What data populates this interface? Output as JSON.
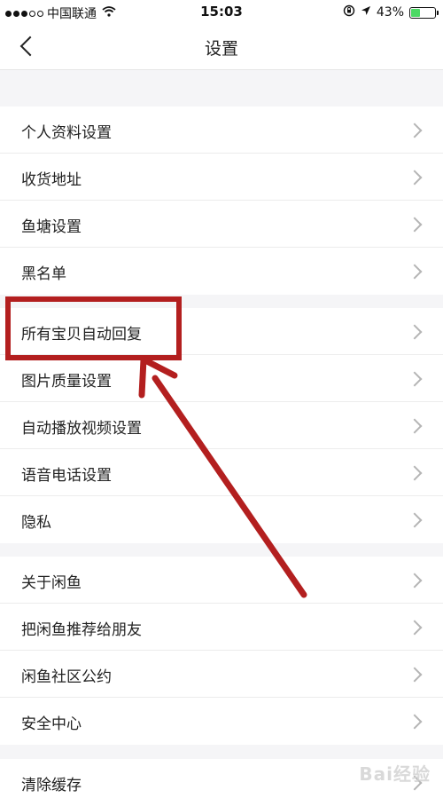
{
  "status_bar": {
    "carrier": "中国联通",
    "time": "15:03",
    "battery": "43%",
    "battery_level": 0.43
  },
  "nav": {
    "title": "设置"
  },
  "groups": [
    {
      "items": [
        {
          "label": "个人资料设置"
        },
        {
          "label": "收货地址"
        },
        {
          "label": "鱼塘设置"
        },
        {
          "label": "黑名单"
        }
      ]
    },
    {
      "items": [
        {
          "label": "所有宝贝自动回复"
        },
        {
          "label": "图片质量设置"
        },
        {
          "label": "自动播放视频设置"
        },
        {
          "label": "语音电话设置"
        },
        {
          "label": "隐私"
        }
      ]
    },
    {
      "items": [
        {
          "label": "关于闲鱼"
        },
        {
          "label": "把闲鱼推荐给朋友"
        },
        {
          "label": "闲鱼社区公约"
        },
        {
          "label": "安全中心"
        }
      ]
    },
    {
      "items": [
        {
          "label": "清除缓存"
        }
      ]
    }
  ],
  "annotation": {
    "color": "#b31f1f"
  },
  "watermark": "Bai经验"
}
